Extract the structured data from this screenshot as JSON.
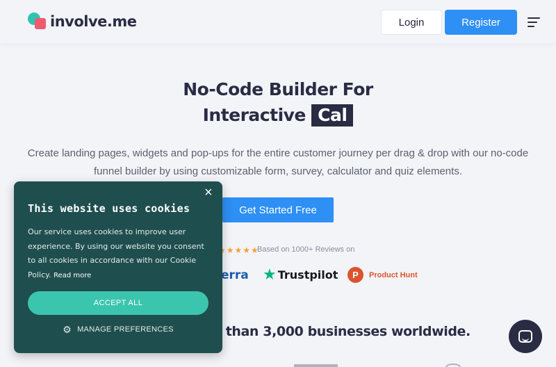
{
  "header": {
    "logo_text": "involve.me",
    "login_label": "Login",
    "register_label": "Register",
    "menu_icon": "hamburger-menu-icon"
  },
  "hero": {
    "title_line1": "No-Code Builder For",
    "title_line2_prefix": "Interactive",
    "title_rotating": "Cal",
    "subtitle": "Create landing pages, widgets and pop-ups for the entire customer journey per drag & drop with our no-code funnel builder by using customizable form, survey, calculator and quiz elements.",
    "cta_label": "Get Started Free"
  },
  "reviews": {
    "stars": "★★★★★",
    "rating": 4.5,
    "text": "Based on 1000+ Reviews on",
    "platforms": {
      "capterra": "erra",
      "trustpilot": "Trustpilot",
      "producthunt_badge": "P",
      "producthunt": "Product Hunt"
    }
  },
  "trusted_text": "e than 3,000 businesses worldwide.",
  "cookie": {
    "title": "This website uses cookies",
    "body": "Our service uses cookies to improve user experience. By using our website you consent to all cookies in accordance with our Cookie Policy.",
    "read_more": "Read more",
    "accept_label": "ACCEPT ALL",
    "manage_label": "MANAGE PREFERENCES",
    "close_symbol": "×"
  },
  "colors": {
    "accent": "#2e8ff5",
    "cookie_bg": "#1f4e4e",
    "accept": "#3cc5ae",
    "dark": "#2a2c44"
  }
}
